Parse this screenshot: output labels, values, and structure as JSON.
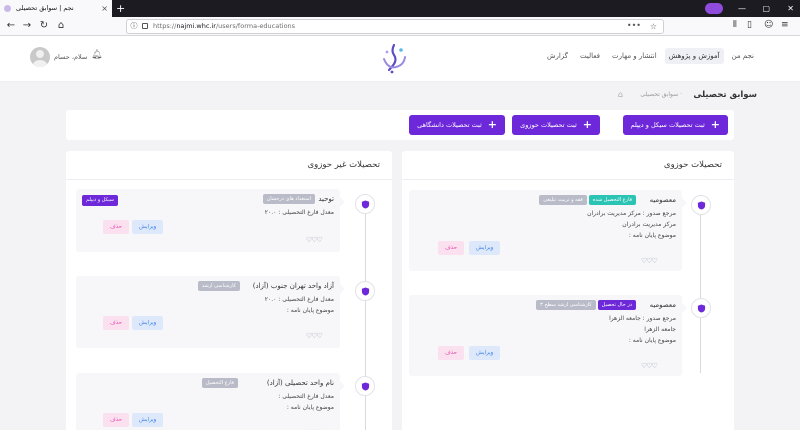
{
  "browser": {
    "tab_title": "نجم | سوابق تحصیلی",
    "url_prefix": "https://",
    "url_host": "najmi.whc.ir",
    "url_path": "/users/forma-educations"
  },
  "header": {
    "menu": [
      {
        "label": "نجم من",
        "active": false
      },
      {
        "label": "آموزش و پژوهش",
        "active": true
      },
      {
        "label": "انتشار و مهارت",
        "active": false
      },
      {
        "label": "فعالیت",
        "active": false
      },
      {
        "label": "گزارش",
        "active": false
      }
    ],
    "greeting": "سلام، حسام"
  },
  "breadcrumb": {
    "title": "سوابق تحصیلی",
    "trail": "سوابق تحصیلی ·"
  },
  "actions": {
    "btn_seminary": "ثبت تحصیلات سیکل و دیپلم",
    "btn_hawza": "ثبت تحصیلات حوزوی",
    "btn_university": "ثبت تحصیلات دانشگاهی"
  },
  "hawza_panel": {
    "title": "تحصیلات حوزوی",
    "cards": [
      {
        "title": "معصومیه",
        "badges": [
          "فارغ التحصیل شده",
          "فقه و تربیت تبلیغی"
        ],
        "lines": [
          "مرجع صدور : مرکز مدیریت برادران",
          "مرکز مدیریت برادران",
          "موضوع پایان نامه :"
        ],
        "edit": "ویرایش",
        "delete": "حذف"
      },
      {
        "title": "معصومیه",
        "badges": [
          "در حال تحصیل",
          "کارشناسی ارشد سطح ۳"
        ],
        "lines": [
          "مرجع صدور : جامعه الزهرا",
          "جامعه الزهرا",
          "موضوع پایان نامه :"
        ],
        "edit": "ویرایش",
        "delete": "حذف"
      }
    ]
  },
  "non_hawza_panel": {
    "title": "تحصیلات غیر حوزوی",
    "cards": [
      {
        "title": "توحید",
        "tag": "سیکل و دیپلم",
        "badges": [
          "استعداد های درخشان"
        ],
        "lines": [
          "معدل فارغ التحصیلی : ۲۰.۰"
        ],
        "edit": "ویرایش",
        "delete": "حذف"
      },
      {
        "title": "آزاد واحد تهران جنوب (آزاد)",
        "badges": [
          "کارشناسی ارشد"
        ],
        "lines": [
          "معدل فارغ التحصیلی : ۲۰.۰",
          "موضوع پایان نامه :"
        ],
        "edit": "ویرایش",
        "delete": "حذف"
      },
      {
        "title": "نام واحد تحصیلی (آزاد)",
        "badges": [
          "فارغ التحصیل"
        ],
        "lines": [
          "معدل فارغ التحصیلی :",
          "موضوع پایان نامه :"
        ],
        "edit": "ویرایش",
        "delete": "حذف"
      }
    ]
  },
  "colors": {
    "accent": "#6d28d9",
    "teal": "#2bc4b4",
    "edit": "#3d7ee6",
    "delete": "#e44aa9"
  }
}
